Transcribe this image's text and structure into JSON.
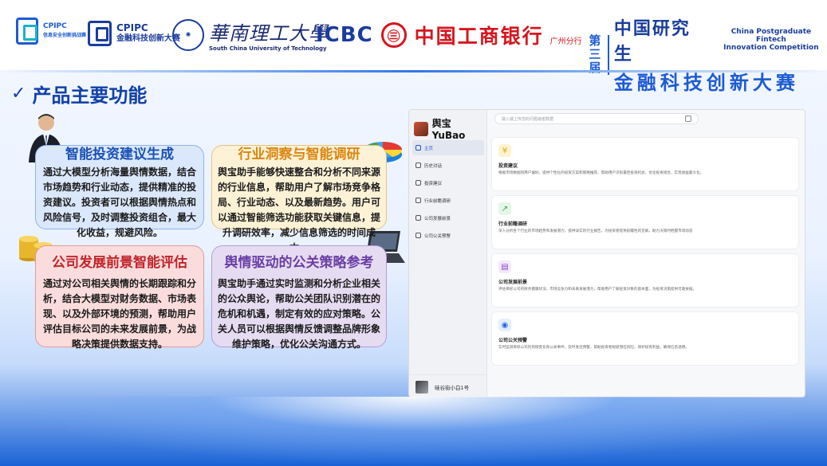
{
  "header": {
    "cpipc1": {
      "en": "CPIPC",
      "cn": "信息安全创新挑战赛"
    },
    "cpipc2": {
      "en": "CPIPC",
      "cn": "金融科技创新大赛"
    },
    "scut": {
      "cn": "華南理工大學",
      "en": "South China University of Technology"
    },
    "icbc": {
      "en": "ICBC",
      "mark": "㊂",
      "cn": "中国工商银行",
      "branch": "广州分行"
    },
    "competition": {
      "di": [
        "第",
        "三",
        "届"
      ],
      "cn_top": "中国研究生",
      "en_line1": "China Postgraduate Fintech",
      "en_line2": "Innovation Competition",
      "cn_bottom": "金融科技创新大赛"
    }
  },
  "title": "产品主要功能",
  "cards": [
    {
      "title": "智能投资建议生成",
      "body": "通过大模型分析海量舆情数据，结合市场趋势和行业动态，提供精准的投资建议。投资者可以根据舆情热点和风险信号，及时调整投资组合，最大化收益，规避风险。"
    },
    {
      "title": "行业洞察与智能调研",
      "body": "舆宝助手能够快速整合和分析不同来源的行业信息，帮助用户了解市场竞争格局、行业动态、以及最新趋势。用户可以通过智能筛选功能获取关键信息，提升调研效率，减少信息筛选的时间成本。"
    },
    {
      "title": "公司发展前景智能评估",
      "body": "通过对公司相关舆情的长期跟踪和分析，结合大模型对财务数据、市场表现、以及外部环境的预测，帮助用户评估目标公司的未来发展前景，为战略决策提供数据支持。"
    },
    {
      "title": "舆情驱动的公关策略参考",
      "body": "舆宝助手通过实时监测和分析企业相关的公众舆论，帮助公关团队识别潜在的危机和机遇，制定有效的应对策略。公关人员可以根据舆情反馈调整品牌形象维护策略，优化公关沟通方式。"
    }
  ],
  "app": {
    "brand": "舆宝 YuBao",
    "search_placeholder": "输入或上传您的问题或者数据",
    "nav": [
      "主页",
      "历史对话",
      "投资建议",
      "行业前瞻调研",
      "公司发展前景",
      "公司公关预警"
    ],
    "user": "硅谷街小白1号",
    "features": [
      {
        "icon": "¥",
        "title": "投资建议",
        "desc": "根据市场数据和用户偏好，提供个性化的投资方案和策略推荐，帮助用户识别最佳投资机会，优化投资组合，实现收益最大化。"
      },
      {
        "icon": "↗",
        "title": "行业前瞻调研",
        "desc": "深入分析各个行业的市场趋势和发展潜力，提供详实的行业报告，为投资者提供前瞻性的见解，助力决策时把握市场动态"
      },
      {
        "icon": "▤",
        "title": "公司发展前景",
        "desc": "评估目标公司的财务健康状况、市场竞争力和未来发展潜力，帮助用户了解投资对象的基本面，为投资决策提供可靠依据。"
      },
      {
        "icon": "◉",
        "title": "公司公关预警",
        "desc": "实时监测目标公司的舆情变化和公关事件，及时发出预警，帮助投资者规避潜在风险，保护投资利益，确保信息透明。"
      }
    ]
  }
}
